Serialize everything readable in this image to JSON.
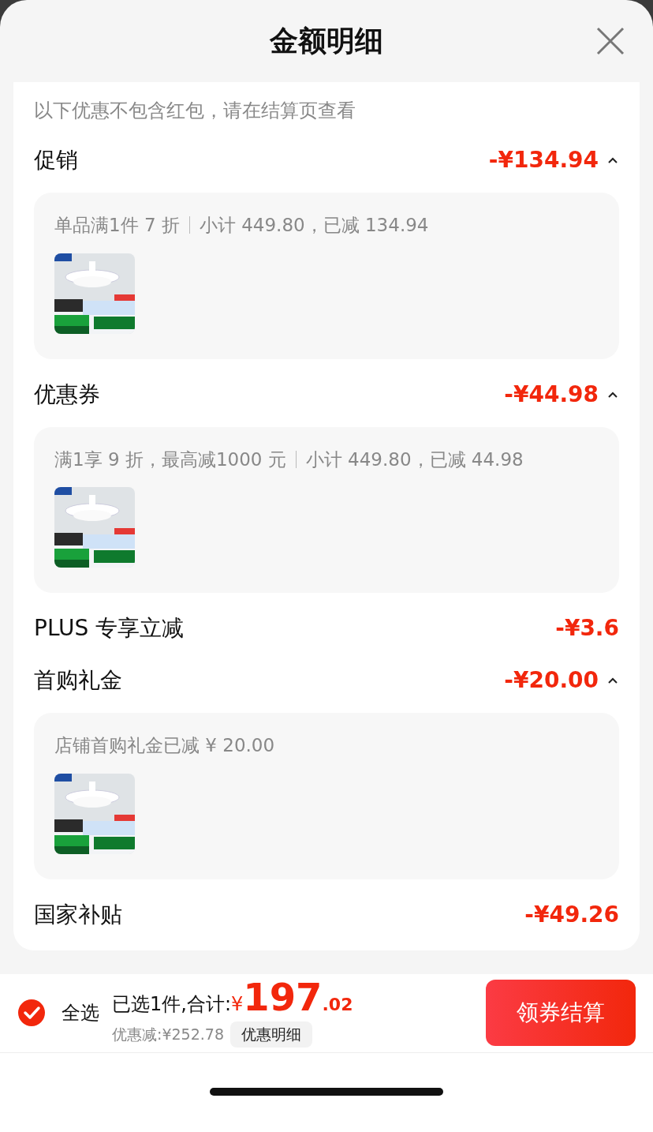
{
  "header": {
    "title": "金额明细"
  },
  "note": "以下优惠不包含红包，请在结算页查看",
  "sections": [
    {
      "kind": "expandable",
      "title": "促销",
      "amount": "-¥134.94",
      "expanded": true,
      "detail": {
        "rule": "单品满1件 7 折",
        "summary": "小计 449.80，已减 134.94"
      }
    },
    {
      "kind": "expandable",
      "title": "优惠券",
      "amount": "-¥44.98",
      "expanded": true,
      "detail": {
        "rule": "满1享 9 折，最高减1000 元",
        "summary": "小计 449.80，已减 44.98"
      }
    },
    {
      "kind": "plain",
      "title": "PLUS 专享立减",
      "amount": "-¥3.6"
    },
    {
      "kind": "expandable",
      "title": "首购礼金",
      "amount": "-¥20.00",
      "expanded": true,
      "detail": {
        "summary": "店铺首购礼金已减 ¥ 20.00"
      }
    },
    {
      "kind": "plain",
      "title": "国家补贴",
      "amount": "-¥49.26"
    }
  ],
  "footer": {
    "select_all": {
      "label": "全选",
      "checked": true
    },
    "selected_text": "已选1件,合计:",
    "currency": "¥",
    "total_int": "197",
    "total_dec": ".02",
    "discount": "优惠减:¥252.78",
    "detail_button": "优惠明细",
    "checkout_button": "领券结算"
  }
}
